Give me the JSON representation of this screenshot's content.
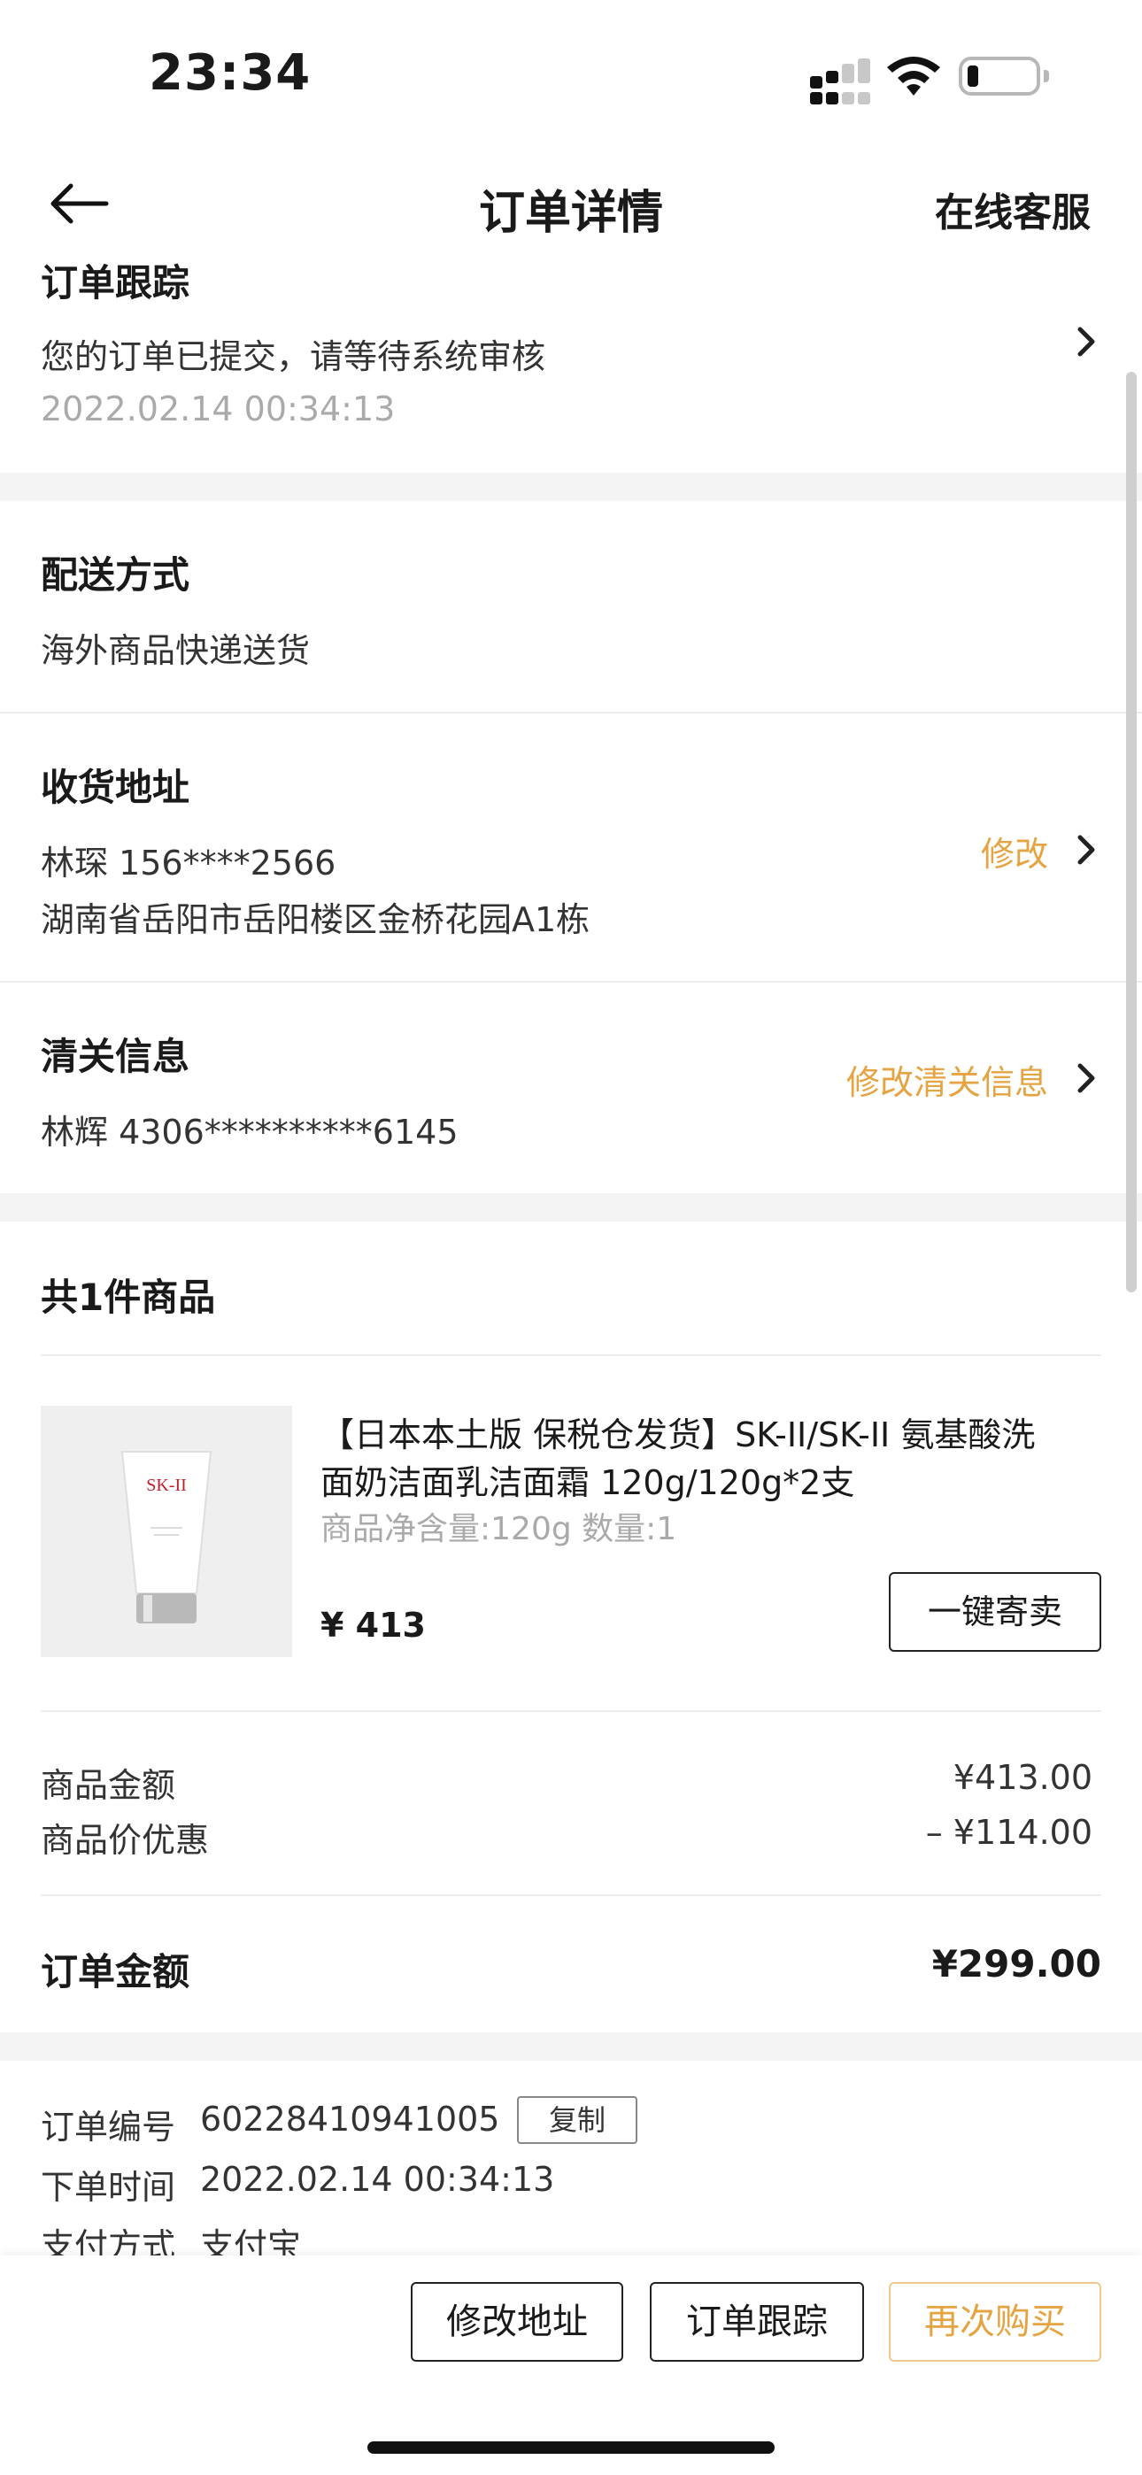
{
  "status": {
    "time": "23:34"
  },
  "nav": {
    "title": "订单详情",
    "service": "在线客服"
  },
  "tracking": {
    "title": "订单跟踪",
    "message": "您的订单已提交，请等待系统审核",
    "time": "2022.02.14 00:34:13"
  },
  "delivery": {
    "title": "配送方式",
    "method": "海外商品快递送货"
  },
  "address": {
    "title": "收货地址",
    "name_phone": "林琛 156****2566",
    "detail": "湖南省岳阳市岳阳楼区金桥花园A1栋",
    "edit": "修改"
  },
  "customs": {
    "title": "清关信息",
    "info": "林辉 4306**********6145",
    "edit": "修改清关信息"
  },
  "goods": {
    "title": "共1件商品",
    "product": {
      "name_line1": "【日本本土版 保税仓发货】SK-II/SK-II  氨基酸洗",
      "name_line2": "面奶洁面乳洁面霜 120g/120g*2支",
      "spec": "商品净含量:120g    数量:1",
      "price": "¥ 413",
      "image_label": "SK-II",
      "consign": "一键寄卖"
    }
  },
  "amounts": {
    "goods_label": "商品金额",
    "goods_value": "¥413.00",
    "discount_label": "商品价优惠",
    "discount_value": "– ¥114.00",
    "total_label": "订单金额",
    "total_value": "¥299.00"
  },
  "order_info": {
    "no_label": "订单编号",
    "no_value": "60228410941005",
    "copy": "复制",
    "time_label": "下单时间",
    "time_value": "2022.02.14 00:34:13",
    "pay_label": "支付方式",
    "pay_value": "支付宝"
  },
  "bottom": {
    "edit_address": "修改地址",
    "track": "订单跟踪",
    "rebuy": "再次购买"
  },
  "colors": {
    "accent": "#e5a441",
    "divider": "#f4f4f4"
  }
}
